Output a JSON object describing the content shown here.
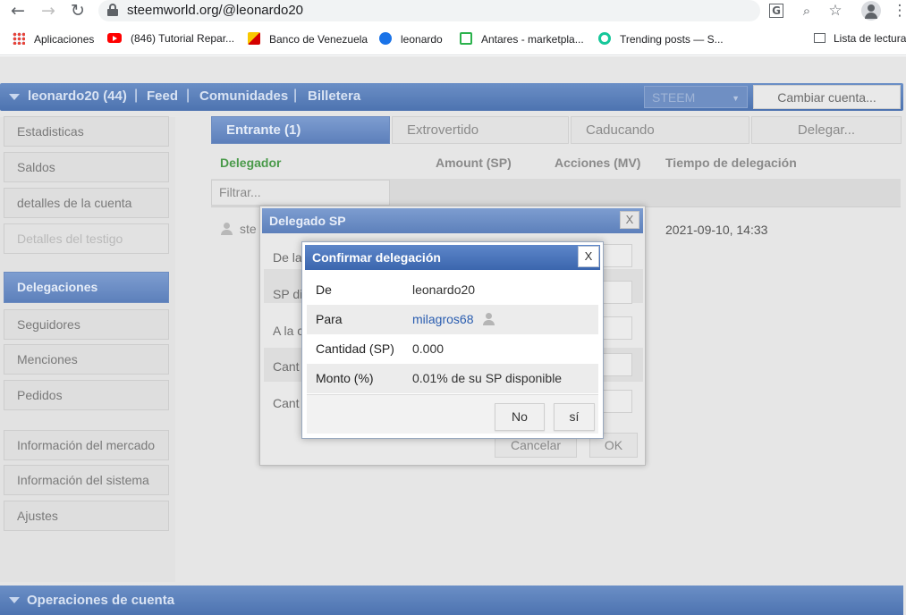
{
  "browser": {
    "back_glyph": "←",
    "forward_glyph": "→",
    "reload_glyph": "↻",
    "url": "steemworld.org/@leonardo20",
    "icons": [
      "translate-icon",
      "zoom-icon",
      "star-icon",
      "profile-icon",
      "menu-icon"
    ],
    "translate_glyph": "G",
    "zoom_glyph": "⌕",
    "star_glyph": "☆",
    "menu_glyph": "⋮",
    "bookmarks": [
      "Aplicaciones",
      "(846) Tutorial Repar...",
      "Banco de Venezuela",
      "leonardo",
      "Antares - marketpla...",
      "Trending posts — S...",
      "Lista de lectura"
    ]
  },
  "navbar": {
    "account": "leonardo20 (44)",
    "sep": "|",
    "feed": "Feed",
    "comunidades": "Comunidades",
    "billetera": "Billetera",
    "currency": "STEEM",
    "cambiar": "Cambiar cuenta..."
  },
  "sidebar": {
    "items": [
      "Estadisticas",
      "Saldos",
      "detalles de la cuenta",
      "Detalles del testigo",
      "Delegaciones",
      "Seguidores",
      "Menciones",
      "Pedidos",
      "Información del mercado",
      "Información del sistema",
      "Ajustes"
    ]
  },
  "tabs": [
    "Entrante (1)",
    "Extrovertido",
    "Caducando",
    "Delegar..."
  ],
  "table": {
    "headers": [
      "Delegador",
      "Amount (SP)",
      "Acciones (MV)",
      "Tiempo de delegación"
    ],
    "filter_placeholder": "Filtrar...",
    "row": {
      "delegator_partial": "ste",
      "time": "2021-09-10, 14:33"
    }
  },
  "bottom_bar": {
    "label": "Operaciones de cuenta"
  },
  "dialog_delegate": {
    "title": "Delegado SP",
    "close": "X",
    "labels": [
      "De la",
      "SP di",
      "A la c",
      "Cant",
      "Cant"
    ],
    "cancel": "Cancelar",
    "ok": "OK"
  },
  "dialog_confirm": {
    "title": "Confirmar delegación",
    "close": "X",
    "rows": [
      {
        "key": "De",
        "value": "leonardo20"
      },
      {
        "key": "Para",
        "value": "milagros68"
      },
      {
        "key": "Cantidad (SP)",
        "value": "0.000"
      },
      {
        "key": "Monto (%)",
        "value": "0.01% de su SP disponible"
      }
    ],
    "no": "No",
    "yes": "sí"
  },
  "colors": {
    "nav_blue": "#4d73b0",
    "dialog_title_blue": "#3b66ae",
    "link_blue": "#2a5db0",
    "delegador_green": "#4a9a4a"
  }
}
